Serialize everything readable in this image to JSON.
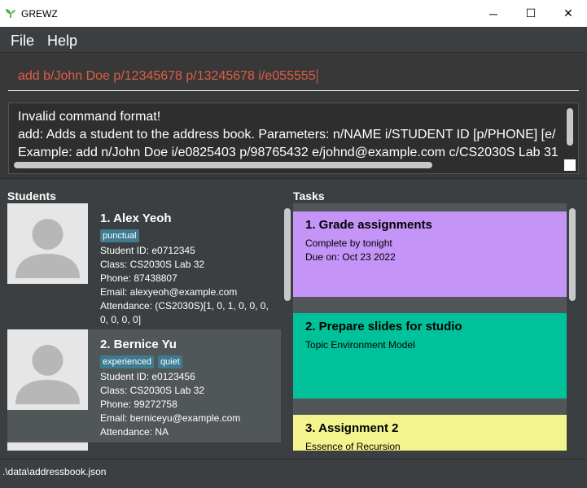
{
  "window": {
    "title": "GREWZ",
    "min_symbol": "─",
    "max_symbol": "☐",
    "close_symbol": "✕"
  },
  "menu": {
    "file": "File",
    "help": "Help"
  },
  "command": {
    "value": "add b/John Doe p/12345678 p/13245678 i/e055555"
  },
  "result": {
    "line1": "Invalid command format!",
    "line2": "add: Adds a student to the address book. Parameters: n/NAME i/STUDENT ID [p/PHONE] [e/",
    "line3": "Example: add n/John Doe i/e0825403 p/98765432 e/johnd@example.com c/CS2030S Lab 31"
  },
  "panels": {
    "students_label": "Students",
    "tasks_label": "Tasks"
  },
  "students": [
    {
      "name": "1.  Alex Yeoh",
      "tags": [
        "punctual"
      ],
      "student_id": "Student ID: e0712345",
      "class": "Class: CS2030S Lab 32",
      "phone": "Phone: 87438807",
      "email": "Email: alexyeoh@example.com",
      "attendance_1": "Attendance: (CS2030S)[1, 0, 1, 0, 0, 0,",
      "attendance_2": "0, 0, 0, 0]"
    },
    {
      "name": "2.  Bernice Yu",
      "tags": [
        "experienced",
        "quiet"
      ],
      "student_id": "Student ID: e0123456",
      "class": "Class: CS2030S Lab 32",
      "phone": "Phone: 99272758",
      "email": "Email: berniceyu@example.com",
      "attendance_1": "Attendance: NA"
    }
  ],
  "tasks": [
    {
      "title": "1.  Grade assignments",
      "line1": "Complete by tonight",
      "line2": "Due on: Oct 23 2022",
      "color": "#c594f7"
    },
    {
      "title": "2.  Prepare slides for studio",
      "line1": "Topic Environment Model",
      "color": "#00c19a"
    },
    {
      "title": "3.  Assignment 2",
      "line1": "Essence of Recursion",
      "color": "#f4f48f"
    }
  ],
  "status": {
    "path": ".\\data\\addressbook.json"
  }
}
